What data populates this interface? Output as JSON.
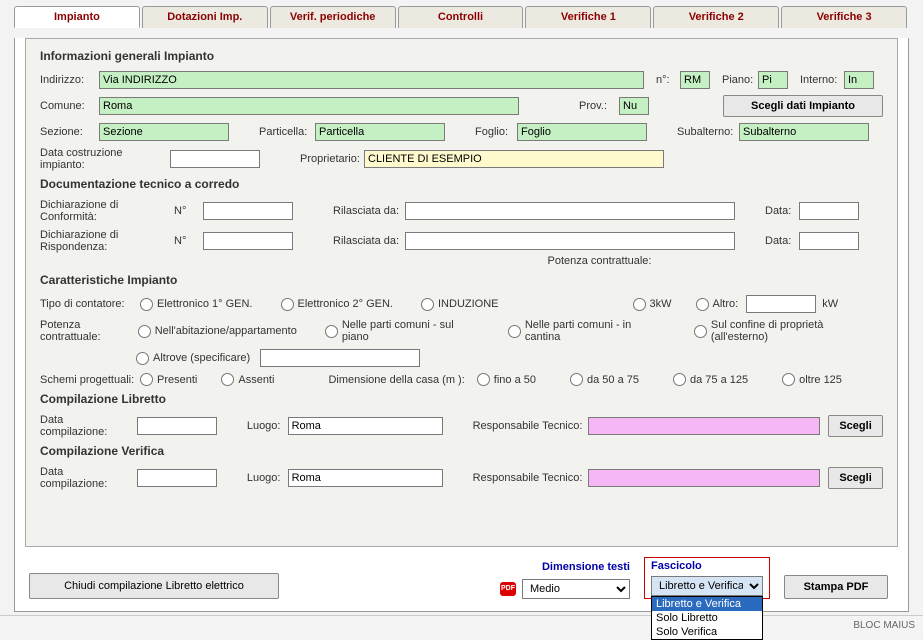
{
  "tabs": {
    "t0": "Impianto",
    "t1": "Dotazioni Imp.",
    "t2": "Verif. periodiche",
    "t3": "Controlli",
    "t4": "Verifiche 1",
    "t5": "Verifiche 2",
    "t6": "Verifiche 3"
  },
  "sections": {
    "info": "Informazioni generali Impianto",
    "doc": "Documentazione tecnico a corredo",
    "car": "Caratteristiche Impianto",
    "clib": "Compilazione Libretto",
    "cver": "Compilazione Verifica"
  },
  "labels": {
    "indirizzo": "Indirizzo:",
    "n": "n°:",
    "piano": "Piano:",
    "interno": "Interno:",
    "comune": "Comune:",
    "prov": "Prov.:",
    "scegli_imp": "Scegli dati Impianto",
    "sezione": "Sezione:",
    "particella": "Particella:",
    "foglio": "Foglio:",
    "subalterno": "Subalterno:",
    "data_costruzione": "Data costruzione impianto:",
    "proprietario": "Proprietario:",
    "dich_conf": "Dichiarazione di Conformità:",
    "dich_risp": "Dichiarazione di Rispondenza:",
    "num": "N°",
    "rilasciata": "Rilasciata da:",
    "data": "Data:",
    "potenza_contr_note": "Potenza contrattuale:",
    "tipo_contatore": "Tipo di contatore:",
    "r_elett1": "Elettronico 1° GEN.",
    "r_elett2": "Elettronico 2° GEN.",
    "r_induz": "INDUZIONE",
    "r_3kw": "3kW",
    "r_altro": "Altro:",
    "kw": "kW",
    "potenza_contr": "Potenza contrattuale:",
    "r_abitaz": "Nell'abitazione/appartamento",
    "r_parti_piano": "Nelle parti comuni - sul piano",
    "r_parti_cantina": "Nelle parti comuni - in cantina",
    "r_confine": "Sul confine di proprietà (all'esterno)",
    "r_altrove": "Altrove (specificare)",
    "schemi": "Schemi progettuali:",
    "r_presenti": "Presenti",
    "r_assenti": "Assenti",
    "dimensione_casa": "Dimensione della casa (m ):",
    "r_fino50": "fino a 50",
    "r_50_75": "da 50 a 75",
    "r_75_125": "da 75 a 125",
    "r_oltre125": "oltre 125",
    "data_compilazione": "Data compilazione:",
    "luogo": "Luogo:",
    "resp_tecnico": "Responsabile Tecnico:",
    "scegli": "Scegli",
    "chiudi": "Chiudi compilazione Libretto elettrico",
    "dim_testi": "Dimensione testi",
    "fascicolo": "Fascicolo",
    "stampa": "Stampa PDF",
    "pdf_icon": "PDF",
    "status": "BLOC MAIUS"
  },
  "values": {
    "indirizzo": "Via INDIRIZZO",
    "n": "RM",
    "piano": "Pi",
    "interno": "In",
    "comune": "Roma",
    "prov": "Nu",
    "sezione": "Sezione",
    "particella": "Particella",
    "foglio": "Foglio",
    "subalterno": "Subalterno",
    "data_costruzione": "",
    "proprietario": "CLIENTE DI ESEMPIO",
    "dich_conf_n": "",
    "dich_conf_ril": "",
    "dich_conf_data": "",
    "dich_risp_n": "",
    "dich_risp_ril": "",
    "dich_risp_data": "",
    "altro_kw": "",
    "altrove": "",
    "lib_data": "",
    "lib_luogo": "Roma",
    "lib_resp": "",
    "ver_data": "",
    "ver_luogo": "Roma",
    "ver_resp": "",
    "dim_testi_sel": "Medio",
    "fasc_sel": "Libretto e Verifica",
    "fasc_opt1": "Libretto e Verifica",
    "fasc_opt2": "Solo Libretto",
    "fasc_opt3": "Solo Verifica"
  }
}
